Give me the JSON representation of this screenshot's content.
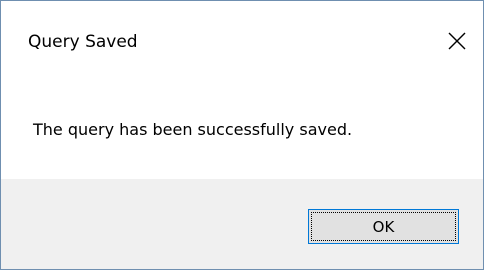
{
  "dialog": {
    "title": "Query Saved",
    "message": "The query has been successfully saved.",
    "ok_label": "OK",
    "close_icon": "close-icon"
  },
  "colors": {
    "border": "#6f8fb0",
    "footer_background": "#f0f0f0",
    "button_background": "#e1e1e1",
    "button_focus_border": "#0078d7"
  }
}
